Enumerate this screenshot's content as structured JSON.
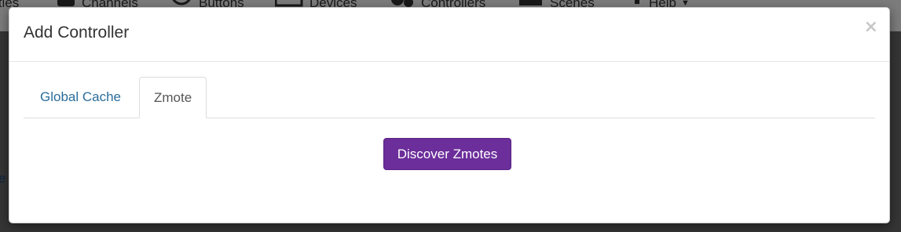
{
  "background_nav": {
    "items": [
      {
        "icon": "ellipsis-icon",
        "label": "ities"
      },
      {
        "icon": "tv-icon",
        "label": "Channels"
      },
      {
        "icon": "circle-icon",
        "label": "Buttons"
      },
      {
        "icon": "monitor-icon",
        "label": "Devices"
      },
      {
        "icon": "gears-icon",
        "label": "Controllers"
      },
      {
        "icon": "picture-icon",
        "label": "Scenes"
      },
      {
        "icon": "help-icon",
        "label": "Help"
      }
    ],
    "left_fragment": "e"
  },
  "modal": {
    "title": "Add Controller",
    "close_label": "×",
    "tabs": [
      {
        "label": "Global Cache",
        "active": false
      },
      {
        "label": "Zmote",
        "active": true
      }
    ],
    "primary_button": {
      "label": "Discover Zmotes",
      "color": "#6b2e9a"
    }
  }
}
